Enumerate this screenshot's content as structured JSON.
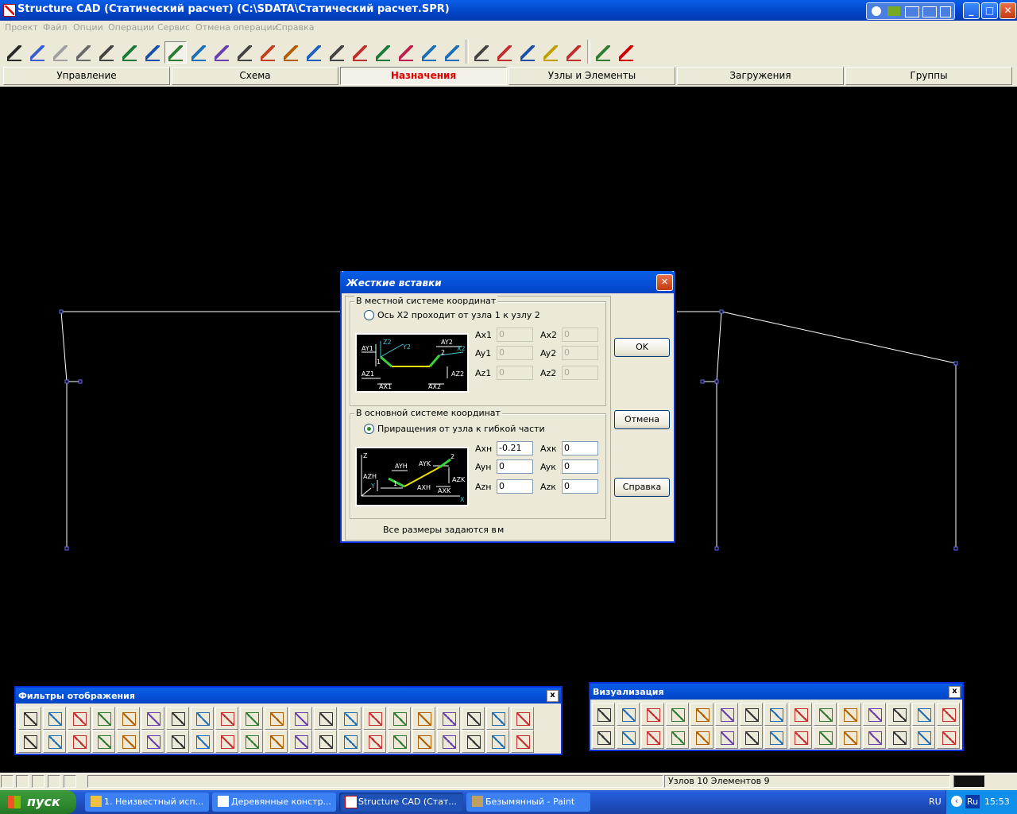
{
  "window": {
    "title": "Structure CAD (Статический расчет) (C:\\SDATA\\Статический расчет.SPR)",
    "controls": {
      "minimize": "_",
      "maximize": "□",
      "close": "✕"
    }
  },
  "menu": [
    "Проект",
    "Файл",
    "Опции",
    "Операции",
    "Сервис",
    "Отмена операции",
    "Справка"
  ],
  "tabs": [
    {
      "label": "Управление",
      "active": false
    },
    {
      "label": "Схема",
      "active": false
    },
    {
      "label": "Назначения",
      "active": true
    },
    {
      "label": "Узлы и Элементы",
      "active": false
    },
    {
      "label": "Загружения",
      "active": false
    },
    {
      "label": "Группы",
      "active": false
    }
  ],
  "toolbar_icons": [
    "assign-stiffness-icon",
    "assign-plate-stiffness-icon",
    "assign-solid-stiffness-icon",
    "assign-elastic-icon",
    "assign-solid-icon",
    "assign-layers-icon",
    "supports-icon",
    "coupled-dof-icon",
    "rigid-inserts-icon",
    "hinges-icon",
    "node-hinges-icon",
    "slope-icon",
    "axis-orientation-icon",
    "local-axes-icon",
    "node-axes-icon",
    "element-axes-icon",
    "type-of-element-icon",
    "section-icon",
    "material-icon",
    "composite-icon",
    "change-type-icon",
    "flip-icon",
    "plot-icon",
    "colors-icon",
    "rigidity-list-icon",
    "check-icon",
    "delete-icon"
  ],
  "toolbar_pressed_index": 7,
  "dialog": {
    "title": "Жесткие вставки",
    "close": "✕",
    "local": {
      "group_title": "В местной системе координат",
      "radio_label": "Ось X2 проходит от узла 1 к узлу 2",
      "fields": [
        {
          "label": "Ax1",
          "value": "0"
        },
        {
          "label": "Ax2",
          "value": "0"
        },
        {
          "label": "Ay1",
          "value": "0"
        },
        {
          "label": "Ay2",
          "value": "0"
        },
        {
          "label": "Az1",
          "value": "0"
        },
        {
          "label": "Az2",
          "value": "0"
        }
      ],
      "diagram_labels": {
        "ay1": "AY1",
        "z2": "Z2",
        "y2": "Y2",
        "ay2": "AY2",
        "x2": "X2",
        "az1": "AZ1",
        "ax1": "AX1",
        "ax2": "AX2",
        "az2": "AZ2",
        "n1": "1",
        "n2": "2"
      }
    },
    "global": {
      "group_title": "В основной системе координат",
      "radio_label": "Приращения от узла к гибкой части",
      "fields": [
        {
          "label": "Axн",
          "value": "-0.21"
        },
        {
          "label": "Axк",
          "value": "0"
        },
        {
          "label": "Ayн",
          "value": "0"
        },
        {
          "label": "Ayк",
          "value": "0"
        },
        {
          "label": "Azн",
          "value": "0"
        },
        {
          "label": "Azк",
          "value": "0"
        }
      ],
      "diagram_labels": {
        "z": "Z",
        "ayh": "AYH",
        "ayk": "AYK",
        "azh": "AZH",
        "axh": "AXH",
        "axk": "AXK",
        "azk": "AZK",
        "y": "Y",
        "x": "X",
        "n1": "1",
        "n2": "2"
      }
    },
    "ok": "OK",
    "cancel": "Отмена",
    "help": "Справка",
    "units_note": "Все размеры задаются в",
    "units": "м"
  },
  "filters_panel": {
    "title": "Фильтры отображения",
    "close": "x",
    "row1_icons": [
      "pencil-icon",
      "eraser-icon",
      "cube-icon",
      "spring-icon",
      "node-numbers-icon",
      "element-numbers-icon",
      "element-types-icon",
      "stiffness-numbers-icon",
      "rigidity-icon",
      "supports-filter-icon",
      "hinges-filter-icon",
      "local-axes-filter-icon",
      "axes-x-icon",
      "axes-y-icon",
      "axes-z-icon",
      "insert-icon",
      "load-values-icon",
      "force-icon",
      "moment-icon",
      "sigma-icon",
      "distributed-icon"
    ],
    "row2_icons": [
      "arrows-icon",
      "grid-icon",
      "table-icon",
      "hatch-icon",
      "eraser2-icon",
      "brush-icon",
      "layers-filter-icon",
      "group-icon",
      "numbers-n-icon",
      "numbers-g-icon",
      "numbers-g2-icon",
      "node-labels-icon",
      "frame-icon",
      "mesh-icon",
      "color-grid-icon",
      "histogram-icon",
      "section-filter-icon",
      "plane-icon",
      "triangle-icon",
      "sum-icon",
      "sum2-icon"
    ]
  },
  "visual_panel": {
    "title": "Визуализация",
    "close": "x",
    "row1_icons": [
      "projection-icon",
      "rotate-x-icon",
      "rotate-y-icon",
      "rotate-z-icon",
      "rotate-z2-icon",
      "rotate-free-icon",
      "rotate-free2-icon",
      "box-frame-icon",
      "box-frame2-icon",
      "box-arrow-icon",
      "box-arrow2-icon",
      "box-cyan-icon",
      "box-cyan2-icon",
      "box-cyan3-icon",
      "box-cyan4-icon"
    ],
    "row2_icons": [
      "cut-icon",
      "fragment-icon",
      "frame-view-icon",
      "dropdown-view-icon",
      "zoom-icon",
      "zoom-reset-icon",
      "print-icon",
      "green-dot-icon",
      "red-dot-icon",
      "picture-icon",
      "dotted-grid-icon",
      "green-grid-icon",
      "hand-icon",
      "hand2-icon",
      "label-box-icon"
    ]
  },
  "status": {
    "nodes_elements": "Узлов 10 Элементов 9"
  },
  "taskbar": {
    "start": "пуск",
    "tasks": [
      {
        "label": "1. Неизвестный исп...",
        "active": false
      },
      {
        "label": "Деревянные констр...",
        "active": false
      },
      {
        "label": "Structure CAD (Стат...",
        "active": true
      },
      {
        "label": "Безымянный - Paint",
        "active": false
      }
    ],
    "lang": "RU",
    "ime": "Ru",
    "clock": "15:53"
  },
  "colors": {
    "accent": "#0244c7",
    "active_tab_text": "#e00000",
    "canvas": "#000000",
    "model_line": "#ffffff",
    "node": "#5a5aff"
  }
}
